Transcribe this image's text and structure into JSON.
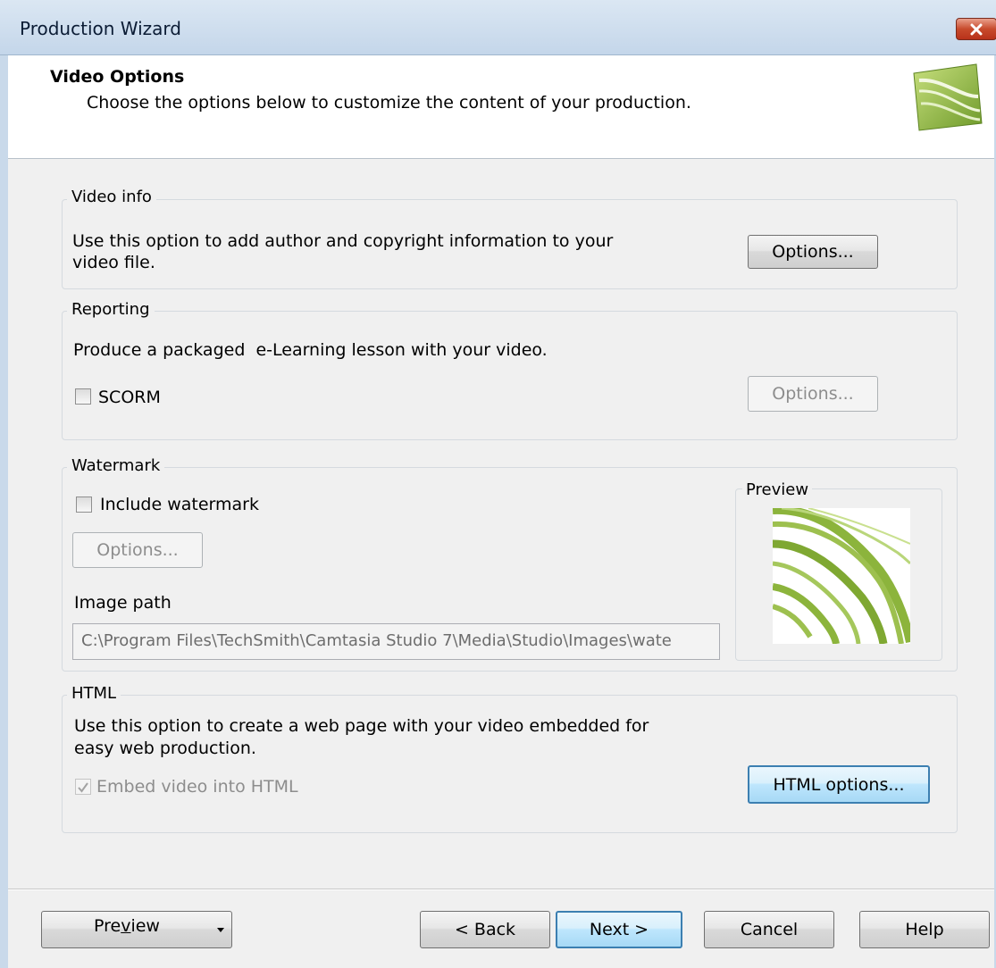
{
  "window": {
    "title": "Production Wizard"
  },
  "header": {
    "title": "Video Options",
    "subtitle": "Choose the options below to customize the content of your production."
  },
  "video_info": {
    "legend": "Video info",
    "desc_line1": "Use this option to add author and copyright information to your",
    "desc_line2": "video file.",
    "options_label": "Options..."
  },
  "reporting": {
    "legend": "Reporting",
    "desc": "Produce a packaged  e-Learning lesson with your video.",
    "scorm_label": "SCORM",
    "scorm_checked": false,
    "options_label": "Options..."
  },
  "watermark": {
    "legend": "Watermark",
    "include_label": "Include watermark",
    "include_checked": false,
    "options_label": "Options...",
    "image_path_label": "Image path",
    "image_path_value": "C:\\Program Files\\TechSmith\\Camtasia Studio 7\\Media\\Studio\\Images\\wate",
    "preview_legend": "Preview"
  },
  "html": {
    "legend": "HTML",
    "desc_line1": "Use this option to create a web page with your video embedded for",
    "desc_line2": "easy web production.",
    "embed_label": "Embed video into HTML",
    "embed_checked": true,
    "html_options_label": "HTML options..."
  },
  "footer": {
    "preview_pre": "Pre",
    "preview_accel": "v",
    "preview_post": "iew",
    "back_label": "< Back",
    "next_label": "Next >",
    "cancel_label": "Cancel",
    "help_label": "Help"
  },
  "colors": {
    "accent_green": "#8cb43c",
    "focus_blue": "#3c7fb1",
    "close_red": "#c74a2c"
  }
}
